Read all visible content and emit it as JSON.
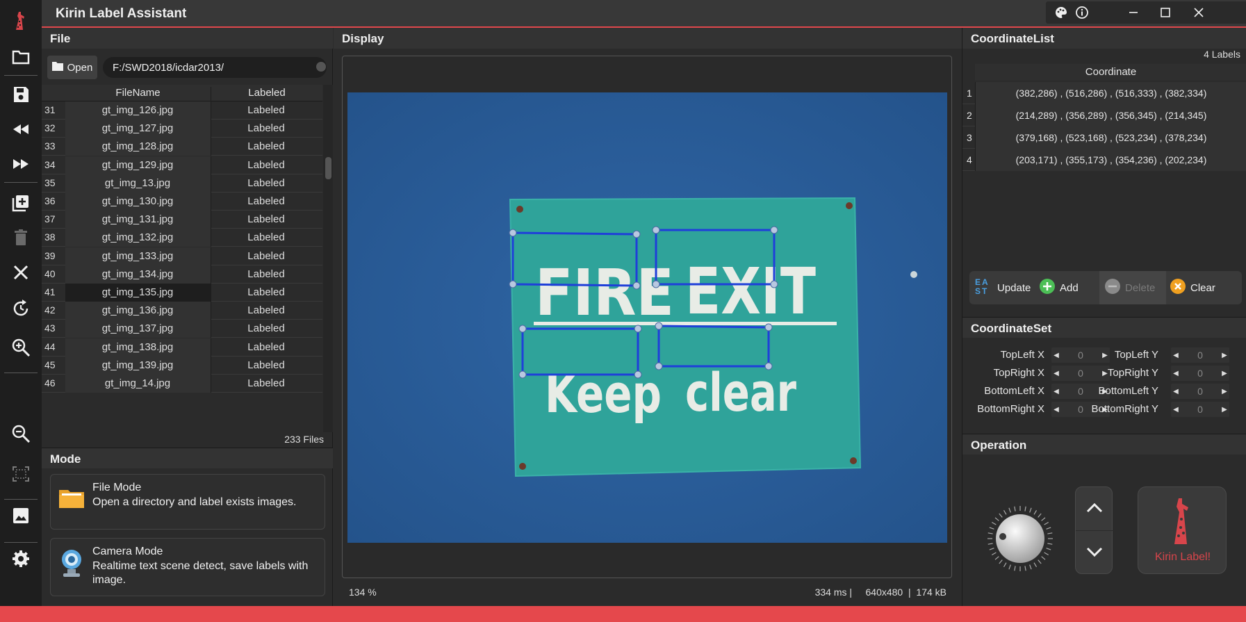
{
  "app": {
    "title": "Kirin Label Assistant"
  },
  "panels": {
    "file": "File",
    "mode": "Mode",
    "display": "Display",
    "coordinate_list": "CoordinateList",
    "coordinate_set": "CoordinateSet",
    "operation": "Operation"
  },
  "file": {
    "open_label": "Open",
    "path": "F:/SWD2018/icdar2013/",
    "columns": [
      "FileName",
      "Labeled"
    ],
    "rows": [
      {
        "n": "31",
        "name": "gt_img_126.jpg",
        "labeled": "Labeled"
      },
      {
        "n": "32",
        "name": "gt_img_127.jpg",
        "labeled": "Labeled"
      },
      {
        "n": "33",
        "name": "gt_img_128.jpg",
        "labeled": "Labeled"
      },
      {
        "n": "34",
        "name": "gt_img_129.jpg",
        "labeled": "Labeled"
      },
      {
        "n": "35",
        "name": "gt_img_13.jpg",
        "labeled": "Labeled"
      },
      {
        "n": "36",
        "name": "gt_img_130.jpg",
        "labeled": "Labeled"
      },
      {
        "n": "37",
        "name": "gt_img_131.jpg",
        "labeled": "Labeled"
      },
      {
        "n": "38",
        "name": "gt_img_132.jpg",
        "labeled": "Labeled"
      },
      {
        "n": "39",
        "name": "gt_img_133.jpg",
        "labeled": "Labeled"
      },
      {
        "n": "40",
        "name": "gt_img_134.jpg",
        "labeled": "Labeled"
      },
      {
        "n": "41",
        "name": "gt_img_135.jpg",
        "labeled": "Labeled"
      },
      {
        "n": "42",
        "name": "gt_img_136.jpg",
        "labeled": "Labeled"
      },
      {
        "n": "43",
        "name": "gt_img_137.jpg",
        "labeled": "Labeled"
      },
      {
        "n": "44",
        "name": "gt_img_138.jpg",
        "labeled": "Labeled"
      },
      {
        "n": "45",
        "name": "gt_img_139.jpg",
        "labeled": "Labeled"
      },
      {
        "n": "46",
        "name": "gt_img_14.jpg",
        "labeled": "Labeled"
      }
    ],
    "selected_row": "41",
    "count": "233 Files"
  },
  "mode": {
    "file_title": "File Mode",
    "file_desc": "Open a directory and label exists images.",
    "camera_title": "Camera Mode",
    "camera_desc": "Realtime text scene detect, save labels with image."
  },
  "display": {
    "zoom": "134 %",
    "info": "334 ms |     640x480  |  174 kB",
    "image_text": {
      "line1_word1": "FIRE",
      "line1_word2": "EXIT",
      "line2_word1": "Keep",
      "line2_word2": "clear"
    }
  },
  "coordinates": {
    "count": "4 Labels",
    "column": "Coordinate",
    "rows": [
      {
        "n": "1",
        "value": "(382,286) , (516,286) , (516,333) , (382,334)"
      },
      {
        "n": "2",
        "value": "(214,289) , (356,289) , (356,345) , (214,345)"
      },
      {
        "n": "3",
        "value": "(379,168) , (523,168) , (523,234) , (378,234)"
      },
      {
        "n": "4",
        "value": "(203,171) , (355,173) , (354,236) , (202,234)"
      }
    ],
    "actions": {
      "update": "Update",
      "add": "Add",
      "delete": "Delete",
      "clear": "Clear",
      "east": "EAST"
    }
  },
  "coord_set": {
    "fields": [
      {
        "label": "TopLeft X",
        "value": "0"
      },
      {
        "label": "TopLeft Y",
        "value": "0"
      },
      {
        "label": "TopRight X",
        "value": "0"
      },
      {
        "label": "TopRight Y",
        "value": "0"
      },
      {
        "label": "BottomLeft X",
        "value": "0"
      },
      {
        "label": "BottomLeft Y",
        "value": "0"
      },
      {
        "label": "BottomRight X",
        "value": "0"
      },
      {
        "label": "BottomRight Y",
        "value": "0"
      }
    ]
  },
  "operation": {
    "kirin_label": "Kirin Label!"
  },
  "colors": {
    "accent": "#e5484c",
    "box": "#1f3fd9",
    "sign": "#2fa39a",
    "board": "#2a5f9d"
  },
  "icons": {
    "toolbar": [
      "giraffe-logo-icon",
      "folder-icon",
      "save-icon",
      "rewind-icon",
      "fast-forward-icon",
      "add-box-icon",
      "trash-icon",
      "close-icon",
      "refresh-icon",
      "zoom-in-icon",
      "zoom-out-icon",
      "fit-screen-icon",
      "image-icon",
      "settings-icon"
    ]
  }
}
